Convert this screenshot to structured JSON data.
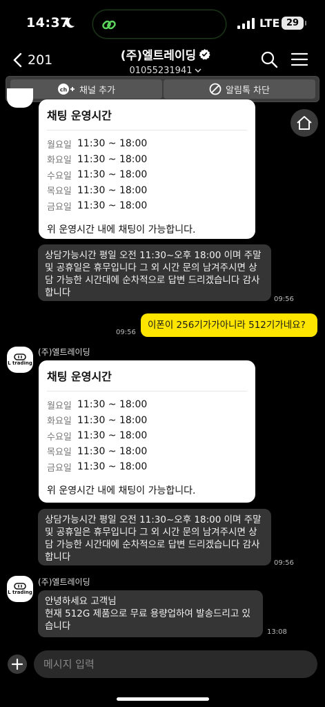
{
  "status_bar": {
    "time": "14:37",
    "network": "LTE",
    "battery": "29"
  },
  "header": {
    "back_count": "201",
    "title": "(주)엘트레이딩",
    "phone": "01055231941"
  },
  "action_bar": {
    "add_channel": "채널 추가",
    "block_alimtalk": "알림톡 차단"
  },
  "hours_card": {
    "title": "채팅 운영시간",
    "rows": [
      {
        "day": "월요일",
        "hours": "11:30 ~ 18:00"
      },
      {
        "day": "화요일",
        "hours": "11:30 ~ 18:00"
      },
      {
        "day": "수요일",
        "hours": "11:30 ~ 18:00"
      },
      {
        "day": "목요일",
        "hours": "11:30 ~ 18:00"
      },
      {
        "day": "금요일",
        "hours": "11:30 ~ 18:00"
      }
    ],
    "footer": "위 운영시간 내에 채팅이 가능합니다."
  },
  "messages": {
    "auto_reply": "상담가능시간 평일 오전 11:30~오후 18:00 이며 주말 및 공휴일은 휴무입니다 그 외 시간 문의 남겨주시면 상담 가능한 시간대에 순차적으로 답변 드리겠습니다 감사합니다",
    "auto_reply_time": "09:56",
    "user_msg": "이폰이 256기가가아니라 512기가네요?",
    "user_msg_time": "09:56",
    "sender_name": "(주)엘트레이딩",
    "auto_reply_2_time": "09:56",
    "reply_line1": "안녕하세요 고객님",
    "reply_line2": "현재 512G 제품으로 무료 용량업하여 발송드리고 있습니다",
    "reply_time": "13:08"
  },
  "avatar_label": "L trading",
  "input": {
    "placeholder": "메시지 입력"
  }
}
